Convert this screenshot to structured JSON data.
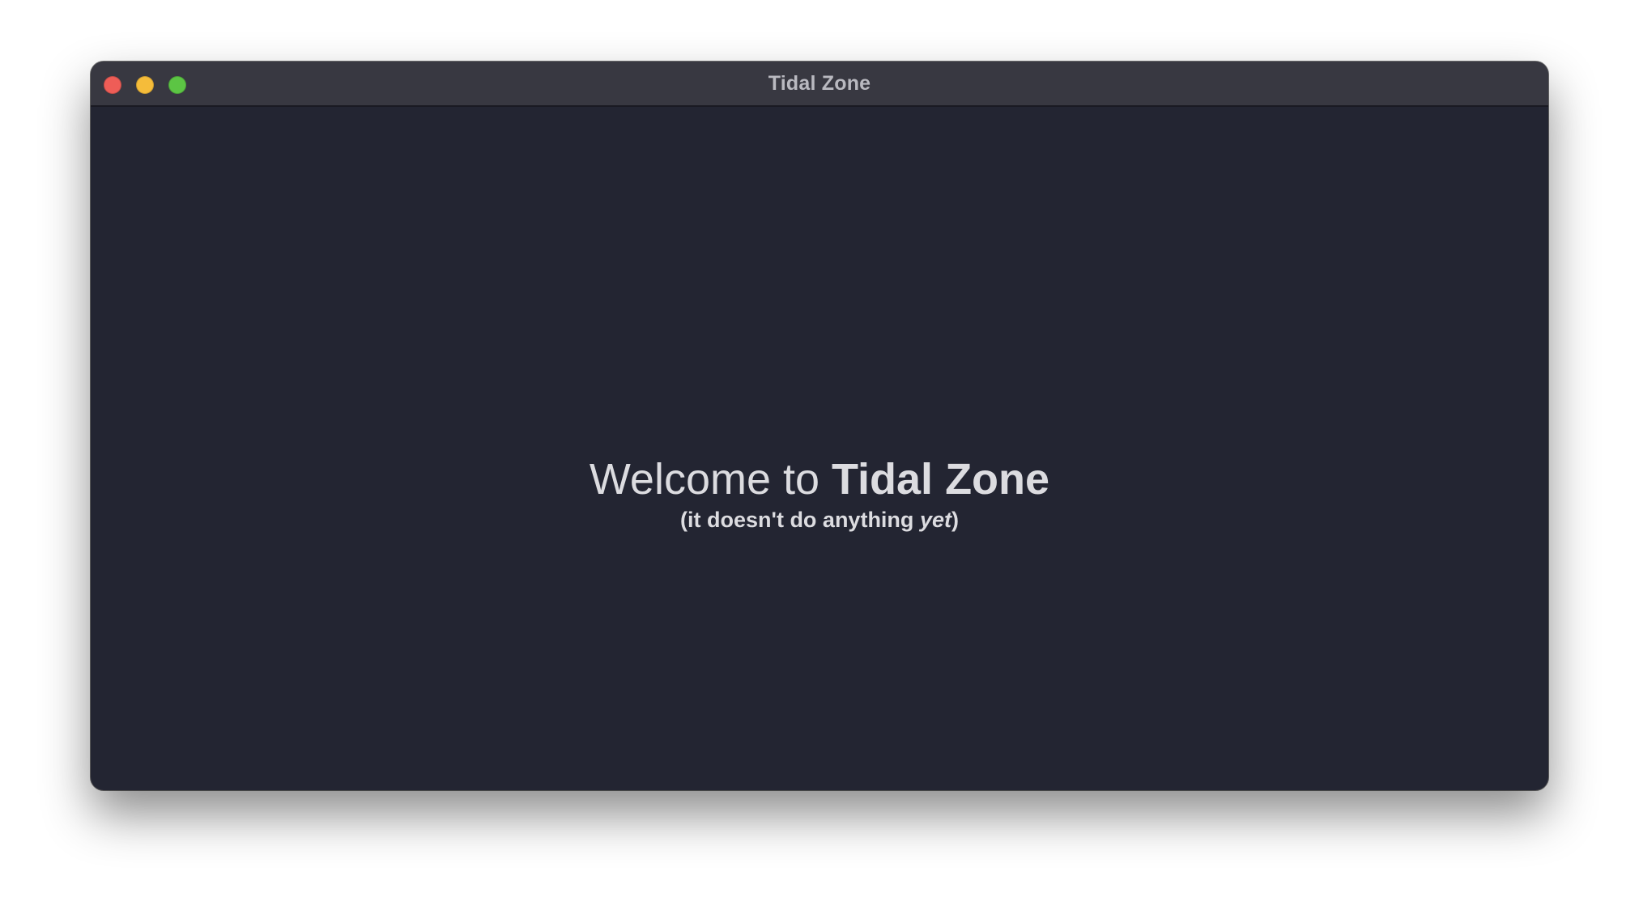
{
  "window": {
    "title": "Tidal Zone",
    "controls": {
      "close": {
        "icon": "close-icon",
        "color": "#ee5d57"
      },
      "minimize": {
        "icon": "minimize-icon",
        "color": "#f5bc3a"
      },
      "zoom": {
        "icon": "zoom-icon",
        "color": "#5cc544"
      }
    }
  },
  "content": {
    "welcome_prefix": "Welcome to ",
    "app_name": "Tidal Zone",
    "subtitle_open": "(it doesn't do anything ",
    "subtitle_emphasis": "yet",
    "subtitle_close": ")"
  },
  "colors": {
    "background": "#232532",
    "titlebar": "#383841",
    "text": "#dcdce0"
  }
}
